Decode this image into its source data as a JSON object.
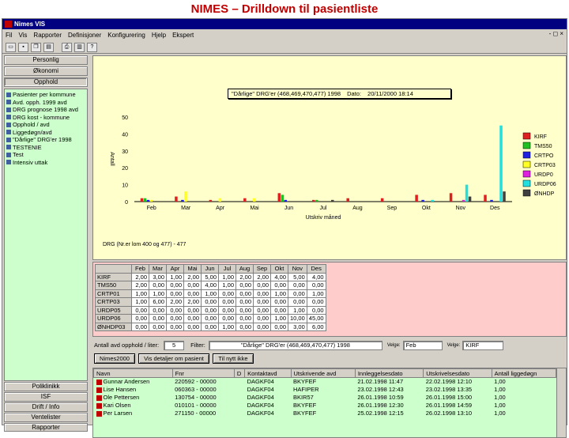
{
  "slide_title": "NIMES – Drilldown til pasientliste",
  "window": {
    "title": "Nimes VIS",
    "menu": [
      "Fil",
      "Vis",
      "Rapporter",
      "Definisjoner",
      "Konfigurering",
      "Hjelp",
      "Ekspert"
    ],
    "mdi_controls": "- ◻ ×"
  },
  "left_panel": {
    "top_buttons": [
      "Personlig",
      "Økonomi",
      "Opphold"
    ],
    "tree_items": [
      "Pasienter per kommune",
      "Avd. opph. 1999 avd",
      "DRG prognose 1998 avd",
      "DRG kost - kommune",
      "Opphold / avd",
      "Liggedøgn/avd",
      "\"Dårlige\" DRG'er 1998",
      "TESTENIE",
      "Test",
      "Intensiv uttak"
    ],
    "bottom_buttons": [
      "Poliklinikk",
      "ISF",
      "Drift / Info",
      "Ventelister",
      "Rapporter"
    ]
  },
  "chart_header": {
    "title": "\"Dårlige\" DRG'er (468,469,470,477) 1998",
    "date_label": "Dato:",
    "date_value": "20/11/2000  18:14"
  },
  "chart_footer": "DRG (Nr.er lom 400 og 477) - 477",
  "chart_data": {
    "type": "bar",
    "title": "\"Dårlige\" DRG'er (468,469,470,477) 1998",
    "xlabel": "Utskriv måned",
    "ylabel": "Antall",
    "categories": [
      "Feb",
      "Mar",
      "Apr",
      "Mai",
      "Jun",
      "Jul",
      "Aug",
      "Sep",
      "Okt",
      "Nov",
      "Des"
    ],
    "ylim": [
      0,
      50
    ],
    "yticks": [
      0,
      10,
      20,
      30,
      40,
      50
    ],
    "series": [
      {
        "name": "KIRF",
        "color": "#e02020",
        "values": [
          2,
          3,
          1,
          2,
          5,
          1,
          2,
          2,
          4,
          5,
          4
        ]
      },
      {
        "name": "TMS50",
        "color": "#20c020",
        "values": [
          2,
          0,
          0,
          0,
          4,
          1,
          0,
          0,
          0,
          0,
          0
        ]
      },
      {
        "name": "CRTPO",
        "color": "#2020e0",
        "values": [
          1,
          1,
          0,
          0,
          1,
          0,
          0,
          0,
          1,
          0,
          1
        ]
      },
      {
        "name": "CRTP03",
        "color": "#ffff20",
        "values": [
          1,
          6,
          2,
          2,
          0,
          0,
          0,
          0,
          0,
          0,
          0
        ]
      },
      {
        "name": "URDP0",
        "color": "#e020e0",
        "values": [
          0,
          0,
          0,
          0,
          0,
          0,
          0,
          0,
          0,
          1,
          0
        ]
      },
      {
        "name": "URDP06",
        "color": "#20e0e0",
        "values": [
          0,
          0,
          0,
          0,
          0,
          0,
          0,
          0,
          1,
          10,
          45
        ]
      },
      {
        "name": "ØNHDP",
        "color": "#404040",
        "values": [
          0,
          0,
          0,
          0,
          0,
          1,
          0,
          0,
          0,
          3,
          6
        ]
      }
    ],
    "legend_position": "right",
    "grid": false
  },
  "grid": {
    "columns": [
      "Feb",
      "Mar",
      "Apr",
      "Mai",
      "Jun",
      "Jul",
      "Aug",
      "Sep",
      "Okt",
      "Nov",
      "Des"
    ],
    "rows": [
      {
        "label": "KIRF",
        "values": [
          "2,00",
          "3,00",
          "1,00",
          "2,00",
          "5,00",
          "1,00",
          "2,00",
          "2,00",
          "4,00",
          "5,00",
          "4,00"
        ]
      },
      {
        "label": "TMS50",
        "values": [
          "2,00",
          "0,00",
          "0,00",
          "0,00",
          "4,00",
          "1,00",
          "0,00",
          "0,00",
          "0,00",
          "0,00",
          "0,00"
        ]
      },
      {
        "label": "CRTP01",
        "values": [
          "1,00",
          "1,00",
          "0,00",
          "0,00",
          "1,00",
          "0,00",
          "0,00",
          "0,00",
          "1,00",
          "0,00",
          "1,00"
        ]
      },
      {
        "label": "CRTP03",
        "values": [
          "1,00",
          "6,00",
          "2,00",
          "2,00",
          "0,00",
          "0,00",
          "0,00",
          "0,00",
          "0,00",
          "0,00",
          "0,00"
        ]
      },
      {
        "label": "URDP05",
        "values": [
          "0,00",
          "0,00",
          "0,00",
          "0,00",
          "0,00",
          "0,00",
          "0,00",
          "0,00",
          "0,00",
          "1,00",
          "0,00"
        ]
      },
      {
        "label": "URDP06",
        "values": [
          "0,00",
          "0,00",
          "0,00",
          "0,00",
          "0,00",
          "0,00",
          "0,00",
          "0,00",
          "1,00",
          "10,00",
          "45,00"
        ]
      },
      {
        "label": "ØNHDP03",
        "values": [
          "0,00",
          "0,00",
          "0,00",
          "0,00",
          "0,00",
          "1,00",
          "0,00",
          "0,00",
          "0,00",
          "3,00",
          "6,00"
        ]
      }
    ]
  },
  "info_bar": {
    "count_label": "Antall avd opphold / liter:",
    "count_value": "5",
    "filter_label": "Filter:",
    "filter_value": "\"Dårlige\" DRG'er (468,469,470,477) 1998",
    "month_label": "Velge:",
    "month_value": "Feb",
    "dept_label": "Velge:",
    "dept_value": "KIRF"
  },
  "action_buttons": [
    "Nimes2000",
    "Vis detaljer om pasient",
    "Til nytt ikke"
  ],
  "patients": {
    "columns": [
      "Navn",
      "Fnr",
      "D",
      "Kontaktavd",
      "Utskrivende avd",
      "Innleggelsesdato",
      "Utskrivelsesdato",
      "Antall liggedøgn"
    ],
    "rows": [
      {
        "navn": "Gunnar Andersen",
        "fnr": "220592 - 00000",
        "d": "",
        "kontaktavd": "DAGKF04",
        "utskr_avd": "BKYFEF",
        "inn": "21.02.1998 11:47",
        "ut": "22.02.1998 12:10",
        "dogn": "1,00"
      },
      {
        "name_placeholder": "",
        "navn": "Lise Hansen",
        "fnr": "060363 - 00000",
        "d": "",
        "kontaktavd": "DAGKF04",
        "utskr_avd": "HAFIPER",
        "inn": "23.02.1998 12:43",
        "ut": "23.02.1998 13:35",
        "dogn": "1,00"
      },
      {
        "navn": "Ole Pettersen",
        "fnr": "130754 - 00000",
        "d": "",
        "kontaktavd": "DAGKF04",
        "utskr_avd": "BKIR57",
        "inn": "26.01.1998 10:59",
        "ut": "26.01.1998 15:00",
        "dogn": "1,00"
      },
      {
        "navn": "Kari Olsen",
        "fnr": "010101 - 00000",
        "d": "",
        "kontaktavd": "DAGKF04",
        "utskr_avd": "BKYFEF",
        "inn": "26.01.1998 12:30",
        "ut": "26.01.1998 14:59",
        "dogn": "1,00"
      },
      {
        "navn": "Per Larsen",
        "fnr": "271150 - 00000",
        "d": "",
        "kontaktavd": "DAGKF04",
        "utskr_avd": "BKYFEF",
        "inn": "25.02.1998 12:15",
        "ut": "26.02.1998 13:10",
        "dogn": "1,00"
      }
    ]
  }
}
